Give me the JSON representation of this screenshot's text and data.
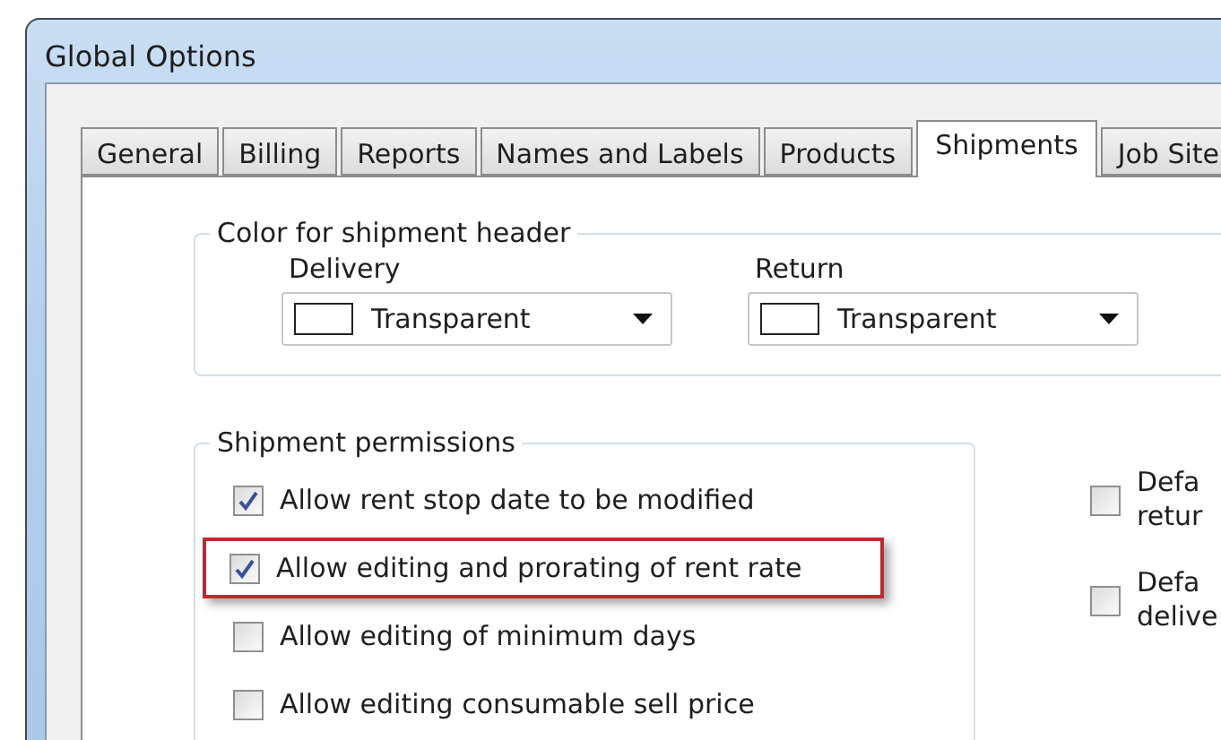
{
  "window": {
    "title": "Global Options"
  },
  "tabs": [
    {
      "label": "General",
      "selected": false
    },
    {
      "label": "Billing",
      "selected": false
    },
    {
      "label": "Reports",
      "selected": false
    },
    {
      "label": "Names and Labels",
      "selected": false
    },
    {
      "label": "Products",
      "selected": false
    },
    {
      "label": "Shipments",
      "selected": true
    },
    {
      "label": "Job Site",
      "selected": false
    }
  ],
  "header_color": {
    "title": "Color for shipment header",
    "pickers": [
      {
        "label": "Delivery",
        "value": "Transparent"
      },
      {
        "label": "Return",
        "value": "Transparent"
      }
    ]
  },
  "permissions": {
    "title": "Shipment permissions",
    "items": [
      {
        "label": "Allow rent stop date to be modified",
        "checked": true,
        "highlighted": false
      },
      {
        "label": "Allow editing and prorating of rent rate",
        "checked": true,
        "highlighted": true
      },
      {
        "label": "Allow editing of minimum days",
        "checked": false,
        "highlighted": false
      },
      {
        "label": "Allow editing consumable sell price",
        "checked": false,
        "highlighted": false
      }
    ]
  },
  "defaults": [
    {
      "lines": [
        "Defa",
        "retur"
      ],
      "checked": false
    },
    {
      "lines": [
        "Defa",
        "delive"
      ],
      "checked": false
    }
  ]
}
